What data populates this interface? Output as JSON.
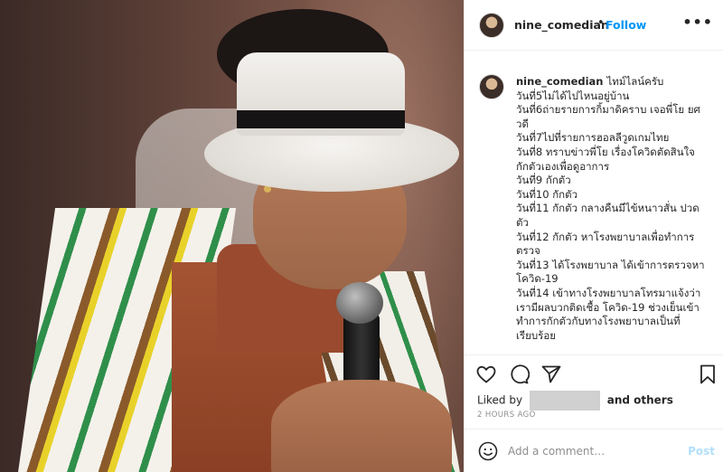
{
  "post": {
    "username": "nine_comedian",
    "follow_label": "Follow",
    "more_label": "•••",
    "separator": "•",
    "caption_lines": [
      "ไทม์ไลน์ครับ",
      "วันที่5ไม่ได้ไปไหนอยู่บ้าน",
      "วันที่6ถ่ายรายการกิ้มาดิคราบ เจอพี่โย ยศ",
      "วดี",
      "วันที่7ไปที่รายการฮอลลีวูดเกมไทย",
      "วันที่8 ทราบข่าวพี่โย เรื่องโควิดตัดสินใจ",
      "กักตัวเองเพื่อดูอาการ",
      "วันที่9 กักตัว",
      "วันที่10 กักตัว",
      "วันที่11 กักตัว กลางคืนมีไข้หนาวสั่น ปวด",
      "ตัว",
      "วันที่12 กักตัว หาโรงพยาบาลเพื่อทำการ",
      "ตรวจ",
      "วันที่13 ได้โรงพยาบาล ได้เข้าการตรวจหา",
      "โควิด-19",
      "วันที่14 เข้าทางโรงพยาบาลโทรมาแจ้งว่า",
      "เรามีผลบวกติดเชื้อ โควิด-19 ช่วงเย็นเข้า",
      "ทำการกักตัวกับทางโรงพยาบาลเป็นที่",
      "เรียบร้อย"
    ],
    "liked_by_label": "Liked by",
    "others_label": "and others",
    "timestamp": "2 HOURS AGO",
    "comment_placeholder": "Add a comment…",
    "post_label": "Post"
  },
  "icons": {
    "like": "heart-icon",
    "comment": "comment-icon",
    "share": "share-icon",
    "save": "bookmark-icon",
    "emoji": "emoji-icon"
  },
  "colors": {
    "link_blue": "#0095f6",
    "post_disabled": "#b2dffc",
    "muted": "#8e8e8e"
  }
}
